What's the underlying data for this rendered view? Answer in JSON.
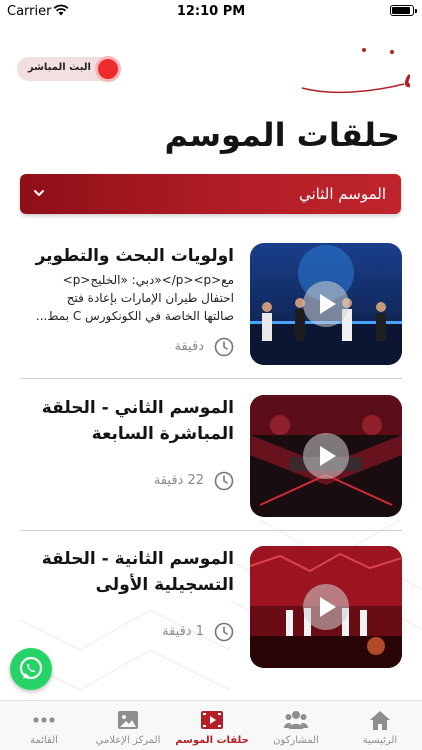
{
  "status_bar": {
    "carrier": "Carrier",
    "time": "12:10 PM"
  },
  "header": {
    "live_label": "البث المباشر",
    "logo_text": "الكونكورس",
    "page_title": "حلقات الموسم"
  },
  "season_selector": {
    "selected": "الموسم الثاني",
    "icon": "chevron-down-icon"
  },
  "episodes": [
    {
      "title": "اولويات البحث والتطوير",
      "description": "مع<p><p/>«دبي: «الخليج<p>\nاحتفال طيران الإمارات بإعادة فتح\nصالتها الخاصة في الكونكورس C بمط...",
      "duration": "دقيقة"
    },
    {
      "title": "الموسم الثاني - الحلقة المباشرة السابعة",
      "description": "",
      "duration": "22 دقيقة"
    },
    {
      "title": "الموسم الثانية - الحلقة التسجيلية الأولى",
      "description": "",
      "duration": "1 دقيقة"
    }
  ],
  "tab_bar": {
    "items": [
      {
        "label": "الرئيسية",
        "icon": "home-icon",
        "active": false
      },
      {
        "label": "المشاركون",
        "icon": "people-icon",
        "active": false
      },
      {
        "label": "حلقات الموسم",
        "icon": "video-icon",
        "active": true
      },
      {
        "label": "المركز الإعلامي",
        "icon": "image-icon",
        "active": false
      },
      {
        "label": "القائمة",
        "icon": "more-icon",
        "active": false
      }
    ]
  },
  "colors": {
    "brand_red": "#b31f26",
    "live_dot": "#ee2a2a",
    "whatsapp_green": "#25d366",
    "inactive_tab": "#8e8e8e"
  }
}
